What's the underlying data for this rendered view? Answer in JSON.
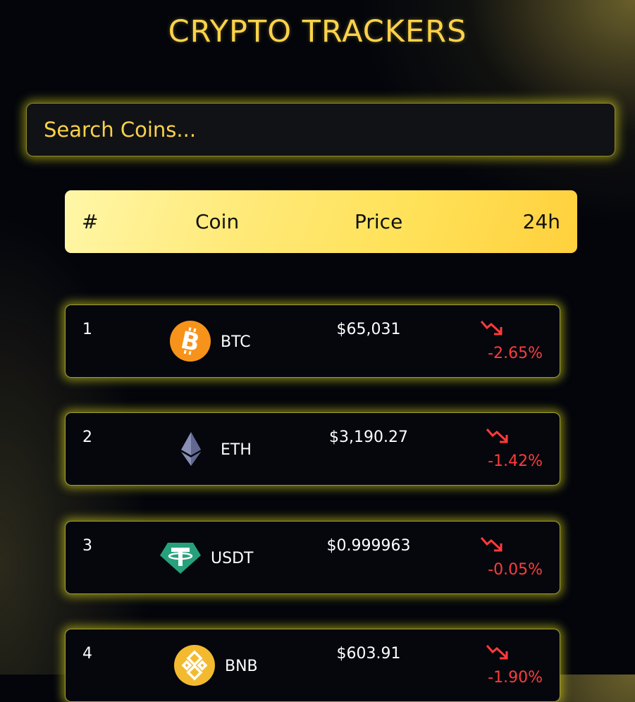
{
  "title": "CRYPTO TRACKERS",
  "search": {
    "placeholder": "Search Coins..."
  },
  "header": {
    "rank": "#",
    "coin": "Coin",
    "price": "Price",
    "change": "24h"
  },
  "coins": [
    {
      "rank": "1",
      "symbol": "BTC",
      "price": "$65,031",
      "change": "-2.65%",
      "icon": "bitcoin-icon",
      "color": "#f7931a"
    },
    {
      "rank": "2",
      "symbol": "ETH",
      "price": "$3,190.27",
      "change": "-1.42%",
      "icon": "ethereum-icon",
      "color": "#8a8fb5"
    },
    {
      "rank": "3",
      "symbol": "USDT",
      "price": "$0.999963",
      "change": "-0.05%",
      "icon": "tether-icon",
      "color": "#26a17b"
    },
    {
      "rank": "4",
      "symbol": "BNB",
      "price": "$603.91",
      "change": "-1.90%",
      "icon": "bnb-icon",
      "color": "#f3ba2f"
    }
  ],
  "colors": {
    "accent": "#fbd24a",
    "negative": "#ff3b3b",
    "glow": "#dcdc1e"
  }
}
